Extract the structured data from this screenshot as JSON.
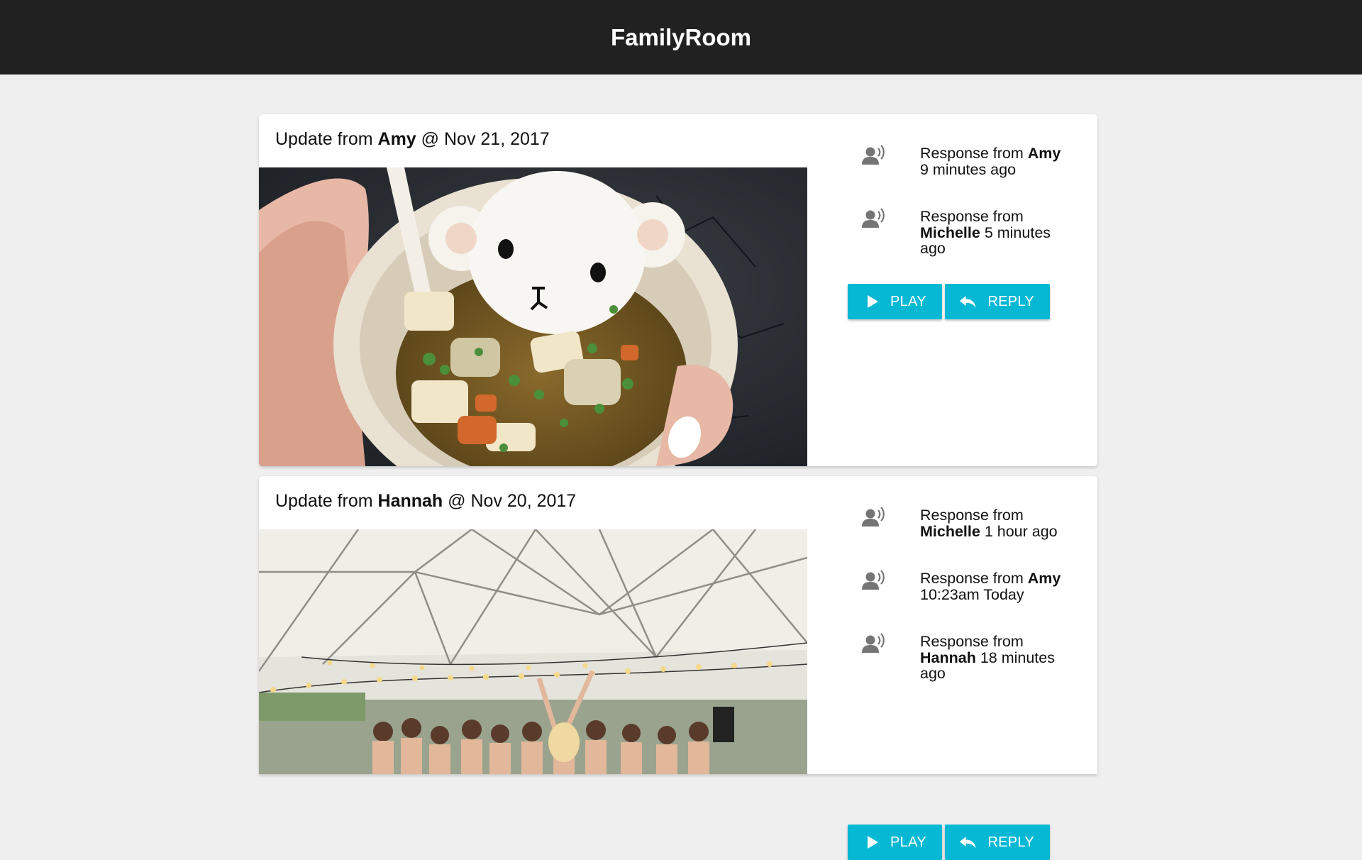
{
  "app": {
    "title": "FamilyRoom"
  },
  "posts": [
    {
      "prefix": "Update from ",
      "author": "Amy",
      "separator": " @ ",
      "date": "Nov 21, 2017",
      "responses": [
        {
          "prefix": "Response from ",
          "author": "Amy",
          "time": " 9 minutes ago"
        },
        {
          "prefix": "Response from ",
          "author": "Michelle",
          "time": " 5 minutes ago"
        }
      ],
      "play_label": "PLAY",
      "reply_label": "REPLY"
    },
    {
      "prefix": "Update from ",
      "author": "Hannah",
      "separator": " @ ",
      "date": "Nov 20, 2017",
      "responses": [
        {
          "prefix": "Response from ",
          "author": "Michelle",
          "time": " 1 hour ago"
        },
        {
          "prefix": "Response from ",
          "author": "Amy",
          "time": " 10:23am Today"
        },
        {
          "prefix": "Response from ",
          "author": "Hannah",
          "time": " 18 minutes ago"
        }
      ],
      "play_label": "PLAY",
      "reply_label": "REPLY"
    }
  ],
  "icons": {
    "response": "voice-person-icon",
    "play": "play-icon",
    "reply": "reply-arrow-icon"
  },
  "colors": {
    "topbar": "#212121",
    "background": "#efefef",
    "accent": "#06b8d4",
    "card": "#ffffff"
  }
}
